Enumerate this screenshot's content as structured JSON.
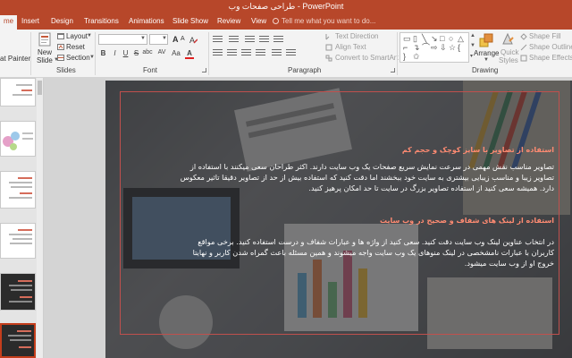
{
  "app": {
    "title": "طراحی صفحات وب - PowerPoint"
  },
  "menu": {
    "tabs": [
      "me",
      "Insert",
      "Design",
      "Transitions",
      "Animations",
      "Slide Show",
      "Review",
      "View"
    ],
    "tell_me": "Tell me what you want to do..."
  },
  "ribbon": {
    "clipboard": {
      "format_painter": "at Painter"
    },
    "slides": {
      "new_slide": "New",
      "new_slide_2": "Slide",
      "layout": "Layout",
      "reset": "Reset",
      "section": "Section",
      "label": "Slides"
    },
    "font": {
      "bold": "B",
      "italic": "I",
      "underline": "U",
      "strike": "S",
      "shadow": "abc",
      "spacing": "AV",
      "case": "Aa",
      "color": "A",
      "label": "Font"
    },
    "paragraph": {
      "text_direction": "Text Direction",
      "align_text": "Align Text",
      "smartart": "Convert to SmartArt",
      "label": "Paragraph"
    },
    "drawing": {
      "arrange": "Arrange",
      "quick_styles": "Quick",
      "quick_styles_2": "Styles",
      "shape_fill": "Shape Fill",
      "shape_outline": "Shape Outline",
      "shape_effects": "Shape Effects",
      "label": "Drawing"
    }
  },
  "slide": {
    "heading1": "استفاده از تصاویر با سایز کوچک و حجم کم",
    "para1": "تصاویر مناسب نقش مهمی در سرعت نمایش سریع صفحات یک وب سایت دارند. اکثر طراحان سعی میکنند با استفاده از تصاویر زیبا و مناسب زیبایی بیشتری به سایت خود ببخشند اما دقت کنید که استفاده بیش از حد از تصاویر دقیقا تاثیر معکوس دارد. همیشه سعی کنید از استفاده تصاویر بزرگ در سایت تا حد امکان پرهیز کنید.",
    "heading2": "استفاده از لینک های شفاف و صحیح در وب سایت",
    "para2": "در انتخاب عناوین لینک وب سایت دقت کنید. سعی کنید از واژه ها و عبارات شفاف و درست استفاده کنید. برخی مواقع کاربران با عبارات نامشخصی در لینک منوهای یک وب سایت واجه میشوند و همین مسئله باعث گمراه شدن کاربر و نهایتا خروج او از وب سایت میشود."
  },
  "colors": {
    "accent": "#b7472a",
    "heading": "#ff8b72",
    "frame": "#c0504d"
  }
}
